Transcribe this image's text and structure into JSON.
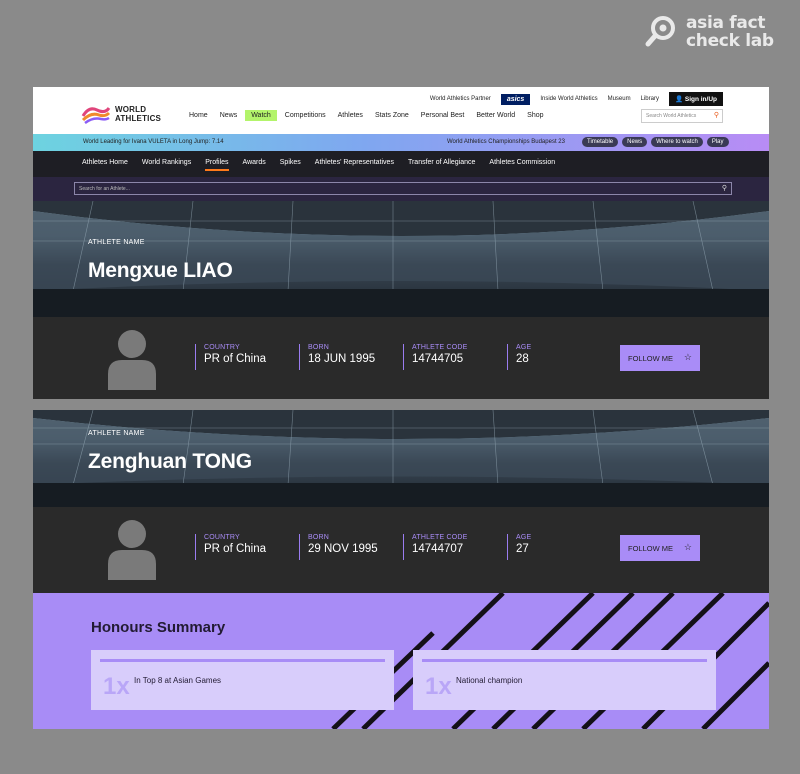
{
  "watermark": {
    "line1": "asia fact",
    "line2": "check lab"
  },
  "header": {
    "logo_line1": "WORLD",
    "logo_line2": "ATHLETICS",
    "partner_label": "World Athletics Partner",
    "partner_brand": "asics",
    "top_links": [
      "Inside World Athletics",
      "Museum",
      "Library"
    ],
    "signin": "Sign in/Up",
    "search_placeholder": "Search World Athletics",
    "nav": [
      "Home",
      "News",
      "Watch",
      "Competitions",
      "Athletes",
      "Stats Zone",
      "Personal Best",
      "Better World",
      "Shop"
    ]
  },
  "ticker": {
    "lead": "World Leading for Ivana VULETA in Long Jump: 7.14",
    "championship": "World Athletics Championships Budapest 23",
    "buttons": [
      "Timetable",
      "News",
      "Where to watch",
      "Play"
    ]
  },
  "subnav": {
    "items": [
      "Athletes Home",
      "World Rankings",
      "Profiles",
      "Awards",
      "Spikes",
      "Athletes' Representatives",
      "Transfer of Allegiance",
      "Athletes Commission"
    ],
    "active": "Profiles",
    "search_placeholder": "Search for an Athlete..."
  },
  "athletes": [
    {
      "label": "ATHLETE NAME",
      "name": "Mengxue LIAO",
      "country_label": "COUNTRY",
      "country": "PR of China",
      "born_label": "BORN",
      "born": "18 JUN 1995",
      "code_label": "ATHLETE CODE",
      "code": "14744705",
      "age_label": "AGE",
      "age": "28",
      "follow": "FOLLOW ME"
    },
    {
      "label": "ATHLETE NAME",
      "name": "Zenghuan TONG",
      "country_label": "COUNTRY",
      "country": "PR of China",
      "born_label": "BORN",
      "born": "29 NOV 1995",
      "code_label": "ATHLETE CODE",
      "code": "14744707",
      "age_label": "AGE",
      "age": "27",
      "follow": "FOLLOW ME"
    }
  ],
  "honours": {
    "title": "Honours Summary",
    "items": [
      {
        "count": "1x",
        "text": "In Top 8 at Asian Games"
      },
      {
        "count": "1x",
        "text": "National champion"
      }
    ]
  },
  "colors": {
    "accent": "#a88cf6",
    "watch": "#b3f46b",
    "dark": "#2a2a2a"
  }
}
